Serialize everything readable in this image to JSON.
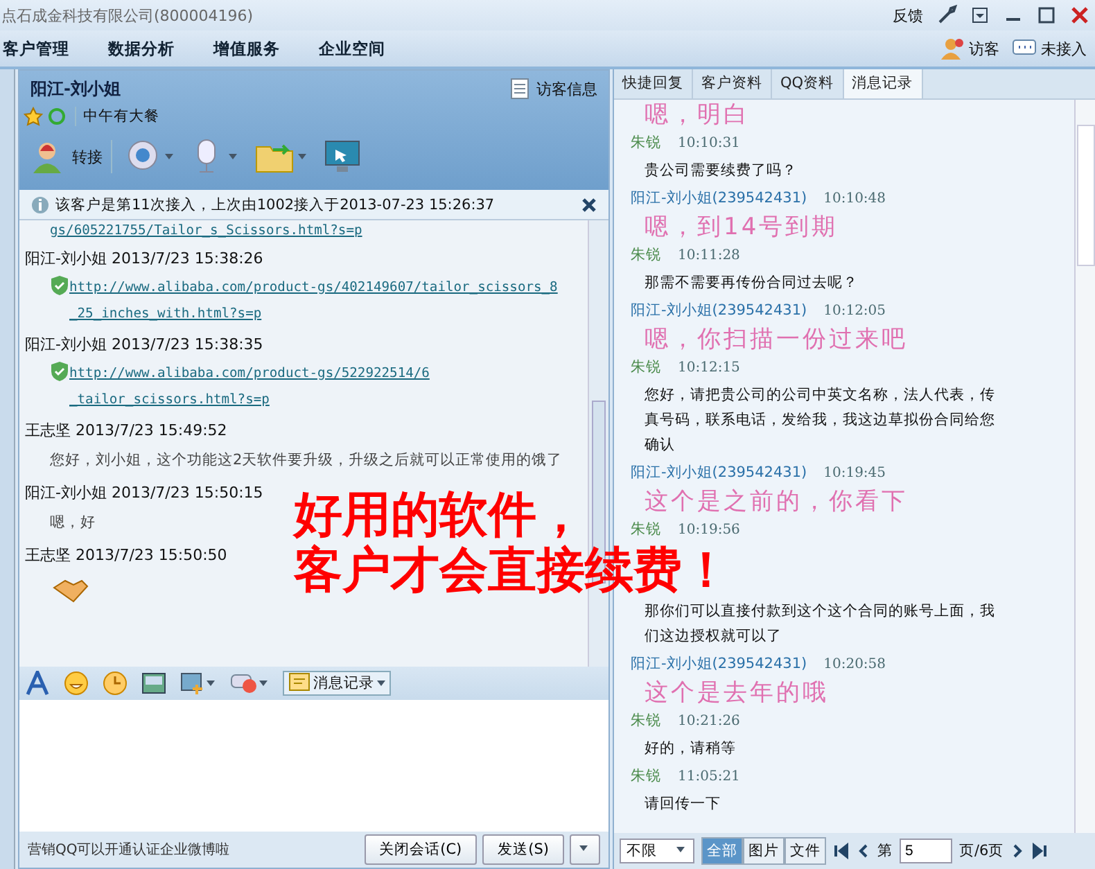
{
  "window": {
    "title": "点石成金科技有限公司(800004196)",
    "controls": [
      "反馈"
    ]
  },
  "menu": [
    {
      "label": "客户管理"
    },
    {
      "label": "数据分析"
    },
    {
      "label": "增值服务"
    },
    {
      "label": "企业空间"
    }
  ],
  "top_actions": [
    {
      "label": "访客"
    },
    {
      "label": "未接入"
    }
  ],
  "chat": {
    "contact": "阳江-刘小姐",
    "visitor_info": "访客信息",
    "signature": "中午有大餐",
    "transfer": "转接",
    "notice": "该客户是第11次接入，上次由1002接入于2013-07-23 15:26:37",
    "history": [
      {
        "kind": "link",
        "lines": [
          "gs/605221755/Tailor_s_Scissors.html?s=p"
        ],
        "secure": false
      },
      {
        "kind": "header",
        "text": "阳江-刘小姐 2013/7/23 15:38:26"
      },
      {
        "kind": "link",
        "lines": [
          "http://www.alibaba.com/product-gs/402149607/tailor_scissors_8",
          "_25_inches_with.html?s=p"
        ],
        "secure": true
      },
      {
        "kind": "header",
        "text": "阳江-刘小姐 2013/7/23 15:38:35"
      },
      {
        "kind": "link",
        "lines": [
          "http://www.alibaba.com/product-gs/522922514/6",
          "_tailor_scissors.html?s=p"
        ],
        "secure": true
      },
      {
        "kind": "header",
        "text": "王志坚 2013/7/23 15:49:52"
      },
      {
        "kind": "text",
        "text": "您好，刘小姐，这个功能这2天软件要升级，升级之后就可以正常使用的饿了"
      },
      {
        "kind": "header",
        "text": "阳江-刘小姐 2013/7/23 15:50:15"
      },
      {
        "kind": "text",
        "text": "嗯，好"
      },
      {
        "kind": "header",
        "text": "王志坚 2013/7/23 15:50:50"
      },
      {
        "kind": "emoji"
      }
    ],
    "history_button": "消息记录",
    "status": "营销QQ可以开通认证企业微博啦",
    "buttons": [
      "关闭会话(C)",
      "发送(S)"
    ]
  },
  "side": {
    "tabs": [
      {
        "label": "快捷回复",
        "selected": false
      },
      {
        "label": "客户资料",
        "selected": false
      },
      {
        "label": "QQ资料",
        "selected": false
      },
      {
        "label": "消息记录",
        "selected": true
      }
    ],
    "records": [
      {
        "kind": "customer",
        "text": "嗯，明白"
      },
      {
        "kind": "agent",
        "sender": "朱锐",
        "time": "10:10:31",
        "text": "贵公司需要续费了吗？"
      },
      {
        "kind": "customer",
        "sender": "阳江-刘小姐(239542431)",
        "time": "10:10:48",
        "text": "嗯，到14号到期"
      },
      {
        "kind": "agent",
        "sender": "朱锐",
        "time": "10:11:28",
        "text": "那需不需要再传份合同过去呢？"
      },
      {
        "kind": "customer",
        "sender": "阳江-刘小姐(239542431)",
        "time": "10:12:05",
        "text": "嗯，你扫描一份过来吧"
      },
      {
        "kind": "agent",
        "sender": "朱锐",
        "time": "10:12:15",
        "text": "您好，请把贵公司的公司中英文名称，法人代表，传真号码，联系电话，发给我，我这边草拟份合同给您确认"
      },
      {
        "kind": "customer",
        "sender": "阳江-刘小姐(239542431)",
        "time": "10:19:45",
        "text": "这个是之前的，你看下"
      },
      {
        "kind": "agent",
        "sender": "朱锐",
        "time": "10:19:56"
      },
      {
        "kind": "agent",
        "text": "那你们可以直接付款到这个这个合同的账号上面，我们这边授权就可以了"
      },
      {
        "kind": "customer",
        "sender": "阳江-刘小姐(239542431)",
        "time": "10:20:58",
        "text": "这个是去年的哦"
      },
      {
        "kind": "agent",
        "sender": "朱锐",
        "time": "10:21:26",
        "text": "好的，请稍等"
      },
      {
        "kind": "agent",
        "sender": "朱锐",
        "time": "11:05:21",
        "text": "请回传一下"
      }
    ],
    "range": "不限",
    "filters": [
      {
        "label": "全部",
        "selected": true
      },
      {
        "label": "图片",
        "selected": false
      },
      {
        "label": "文件",
        "selected": false
      }
    ],
    "page_prefix": "第",
    "page": "5",
    "page_suffix": "页/6页"
  },
  "overlay": [
    "好用的软件，",
    "客户才会直接续费！"
  ]
}
